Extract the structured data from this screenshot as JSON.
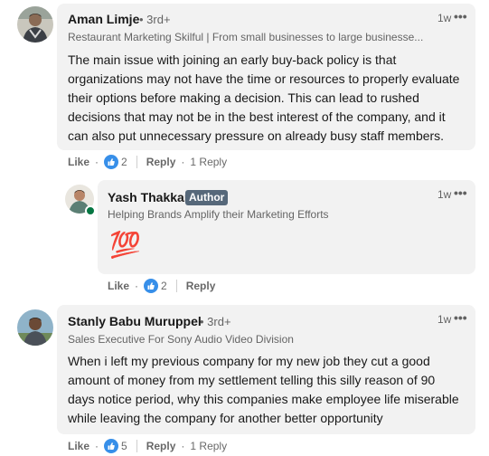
{
  "comments": [
    {
      "author": "Aman Limje",
      "degree": "• 3rd+",
      "headline": "Restaurant Marketing Skilful | From small businesses to large businesse...",
      "time": "1w",
      "more": "•••",
      "lines": [
        "The main issue with joining an early buy-back policy is that",
        "organizations may not have the time or resources to properly evaluate",
        "their options before making a decision. This can lead to rushed",
        "decisions that may not be in the best interest of the company, and it",
        "can also put unnecessary pressure on already busy staff members."
      ],
      "like_label": "Like",
      "like_count": "2",
      "reply_label": "Reply",
      "replies_label": "1 Reply"
    },
    {
      "author": "Yash Thakkar",
      "badge": "Author",
      "headline": "Helping Brands Amplify their Marketing Efforts",
      "time": "1w",
      "more": "•••",
      "emoji": "💯",
      "like_label": "Like",
      "like_count": "2",
      "reply_label": "Reply"
    },
    {
      "author": "Stanly Babu Muruppel",
      "degree": "• 3rd+",
      "headline": "Sales Executive For Sony Audio Video Division",
      "time": "1w",
      "more": "•••",
      "lines": [
        "When i left my previous company for my new job they cut a good",
        "amount of money from my settlement telling this silly reason of 90",
        "days notice period, why this companies make employee life miserable",
        "while leaving the company for another better opportunity"
      ],
      "like_label": "Like",
      "like_count": "5",
      "reply_label": "Reply",
      "replies_label": "1 Reply"
    }
  ],
  "colors": {
    "bubble": "#f2f2f2",
    "like_blue": "#378fe9",
    "badge": "#56687a",
    "online": "#057642"
  }
}
